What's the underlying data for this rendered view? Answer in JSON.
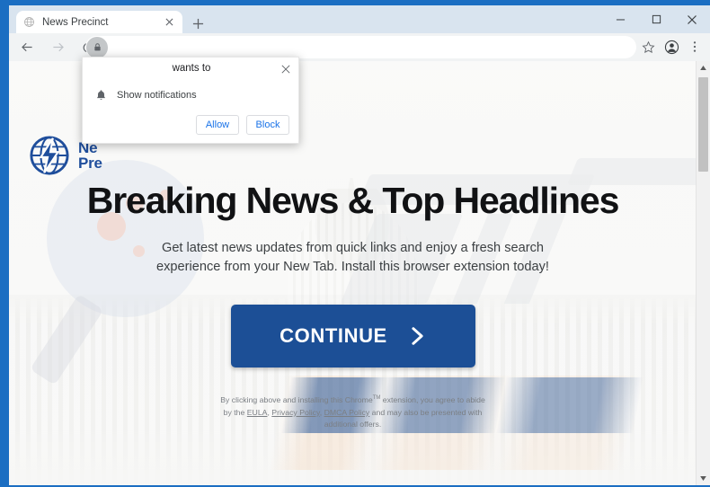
{
  "browser": {
    "tab": {
      "title": "News Precinct",
      "favicon_icon": "globe-icon",
      "close_icon": "close-icon"
    },
    "new_tab_label": "+",
    "window_controls": {
      "minimize_icon": "minimize-icon",
      "maximize_icon": "maximize-icon",
      "close_icon": "close-icon"
    },
    "toolbar": {
      "back_icon": "arrow-left-icon",
      "forward_icon": "arrow-right-icon",
      "reload_icon": "reload-icon",
      "lock_icon": "lock-icon",
      "url_value": "",
      "url_placeholder": "",
      "bookmark_icon": "star-icon",
      "profile_icon": "profile-avatar-icon",
      "menu_icon": "three-dot-menu-icon"
    }
  },
  "permission_popup": {
    "title": "wants to",
    "close_icon": "close-icon",
    "permission_icon": "bell-icon",
    "permission_label": "Show notifications",
    "allow_label": "Allow",
    "block_label": "Block"
  },
  "site": {
    "logo_icon": "globe-lightning-icon",
    "logo_line1": "Ne",
    "logo_line2": "Pre",
    "headline": "Breaking News & Top Headlines",
    "subhead": "Get latest news updates from quick links and enjoy a fresh search experience from your New Tab. Install this browser extension today!",
    "cta_label": "CONTINUE",
    "cta_arrow_icon": "chevron-right-icon",
    "fineprint": {
      "part1": "By clicking above and installing this Chrome",
      "tm": "TM",
      "part2": " extension, you agree to abide by the ",
      "link1": "EULA",
      "sep1": ", ",
      "link2": "Privacy Policy",
      "sep2": ", ",
      "link3": "DMCA Policy",
      "part3": " and may also be presented with additional offers."
    }
  },
  "scrollbar": {
    "up_icon": "caret-up-icon",
    "down_icon": "caret-down-icon"
  },
  "colors": {
    "frame_blue": "#1b6ec2",
    "cta_blue": "#1c4f96",
    "link_blue": "#1a73e8",
    "logo_blue": "#1f4e9c"
  }
}
